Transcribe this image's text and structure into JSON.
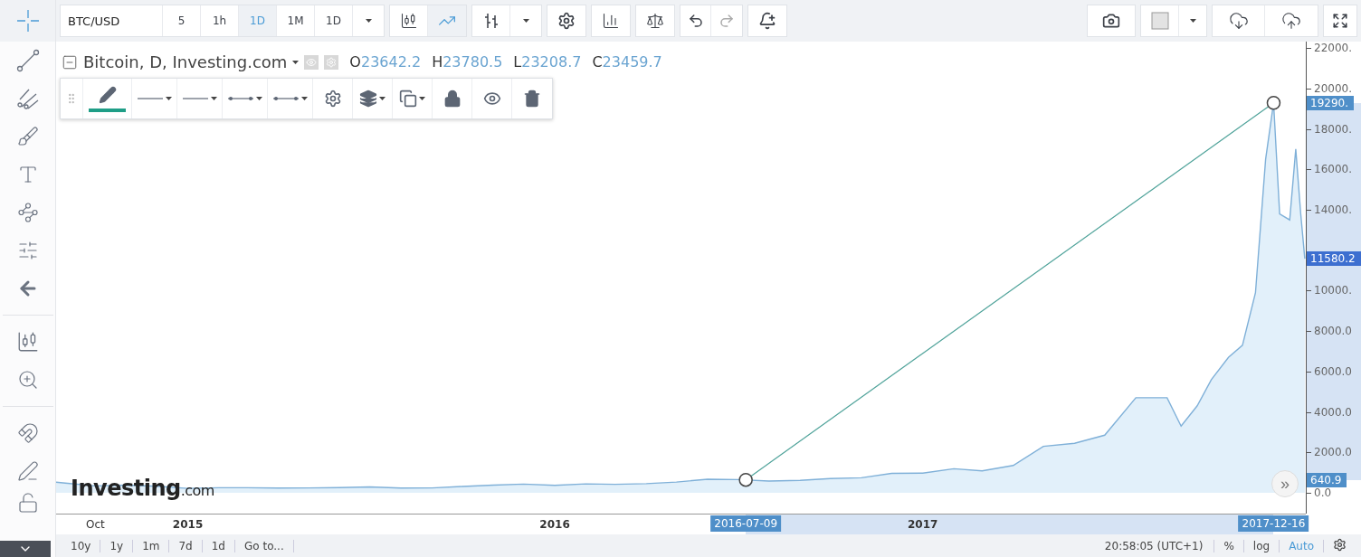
{
  "toolbar": {
    "symbol": "BTC/USD",
    "intervals": [
      {
        "label": "5",
        "selected": false
      },
      {
        "label": "1h",
        "selected": false
      },
      {
        "label": "1D",
        "selected": true
      },
      {
        "label": "1M",
        "selected": false
      },
      {
        "label": "1D",
        "selected": false
      }
    ],
    "chart_types": [
      {
        "selected": false
      },
      {
        "selected": true
      }
    ]
  },
  "legend": {
    "title": "Bitcoin, D, Investing.com",
    "values": [
      {
        "label": "O",
        "value": "23642.2"
      },
      {
        "label": "H",
        "value": "23780.5"
      },
      {
        "label": "L",
        "value": "23208.7"
      },
      {
        "label": "C",
        "value": "23459.7"
      }
    ]
  },
  "drawing_toolbar": {
    "color": "#1f9e87"
  },
  "chart": {
    "logo": "**Investing**.com",
    "scroll_button": "»",
    "chart_data": {
      "type": "area",
      "x": [
        "2014-08-23",
        "2014-09-01",
        "2014-10-01",
        "2014-11-01",
        "2014-12-01",
        "2015-01-01",
        "2015-02-01",
        "2015-03-01",
        "2015-04-01",
        "2015-05-01",
        "2015-06-01",
        "2015-07-01",
        "2015-08-01",
        "2015-09-01",
        "2015-10-01",
        "2015-11-01",
        "2015-12-01",
        "2016-01-01",
        "2016-02-01",
        "2016-03-01",
        "2016-04-01",
        "2016-05-01",
        "2016-06-01",
        "2016-07-01",
        "2016-08-01",
        "2016-09-01",
        "2016-10-01",
        "2016-11-01",
        "2016-12-01",
        "2017-01-01",
        "2017-02-01",
        "2017-03-01",
        "2017-04-01",
        "2017-05-01",
        "2017-06-01",
        "2017-07-01",
        "2017-08-01",
        "2017-09-01",
        "2017-09-15",
        "2017-10-01",
        "2017-10-15",
        "2017-11-01",
        "2017-11-15",
        "2017-11-28",
        "2017-12-08",
        "2017-12-16",
        "2017-12-22",
        "2018-01-01",
        "2018-01-07",
        "2018-01-12",
        "2018-01-16"
      ],
      "series": [
        {
          "color": "#7fb0d8",
          "values": [
            520,
            480,
            340,
            380,
            320,
            220,
            250,
            250,
            230,
            240,
            260,
            290,
            230,
            240,
            310,
            380,
            430,
            370,
            440,
            420,
            450,
            530,
            670,
            650,
            580,
            610,
            700,
            740,
            960,
            970,
            1190,
            1080,
            1350,
            2300,
            2450,
            2850,
            4700,
            4700,
            3300,
            4300,
            5600,
            6700,
            7300,
            9900,
            16500,
            19290,
            13800,
            13500,
            17000,
            13800,
            11580
          ]
        }
      ],
      "xlim": [
        "2014-08-23",
        "2018-01-17"
      ],
      "ylim": [
        -1030,
        22320
      ],
      "xticks": [
        {
          "value": "2014-10-01",
          "label": "Oct"
        },
        {
          "value": "2015-01-01",
          "label": "2015"
        },
        {
          "value": "2016-01-01",
          "label": "2016"
        },
        {
          "value": "2017-01-01",
          "label": "2017"
        }
      ],
      "yticks": [
        {
          "value": 0,
          "label": "0.0"
        },
        {
          "value": 2000,
          "label": "2000.0"
        },
        {
          "value": 4000,
          "label": "4000.0"
        },
        {
          "value": 6000,
          "label": "6000.0"
        },
        {
          "value": 8000,
          "label": "8000.0"
        },
        {
          "value": 10000,
          "label": "10000."
        },
        {
          "value": 14000,
          "label": "14000."
        },
        {
          "value": 16000,
          "label": "16000."
        },
        {
          "value": 18000,
          "label": "18000."
        },
        {
          "value": 20000,
          "label": "20000."
        },
        {
          "value": 22000,
          "label": "22000."
        }
      ]
    },
    "price_markers": [
      {
        "kind": "selection",
        "label": "19290."
      },
      {
        "kind": "last_price",
        "label": "11580.2"
      },
      {
        "kind": "selection",
        "label": "640.9"
      }
    ],
    "time_markers": [
      {
        "label": "2016-07-09"
      },
      {
        "label": "2017-12-16"
      }
    ]
  },
  "bottom_bar": {
    "ranges": [
      "10y",
      "1y",
      "1m",
      "7d",
      "1d",
      "Go to..."
    ],
    "clock": "20:58:05 (UTC+1)",
    "scales": [
      {
        "label": "%",
        "selected": false
      },
      {
        "label": "log",
        "selected": false
      },
      {
        "label": "Auto",
        "selected": true
      }
    ]
  }
}
